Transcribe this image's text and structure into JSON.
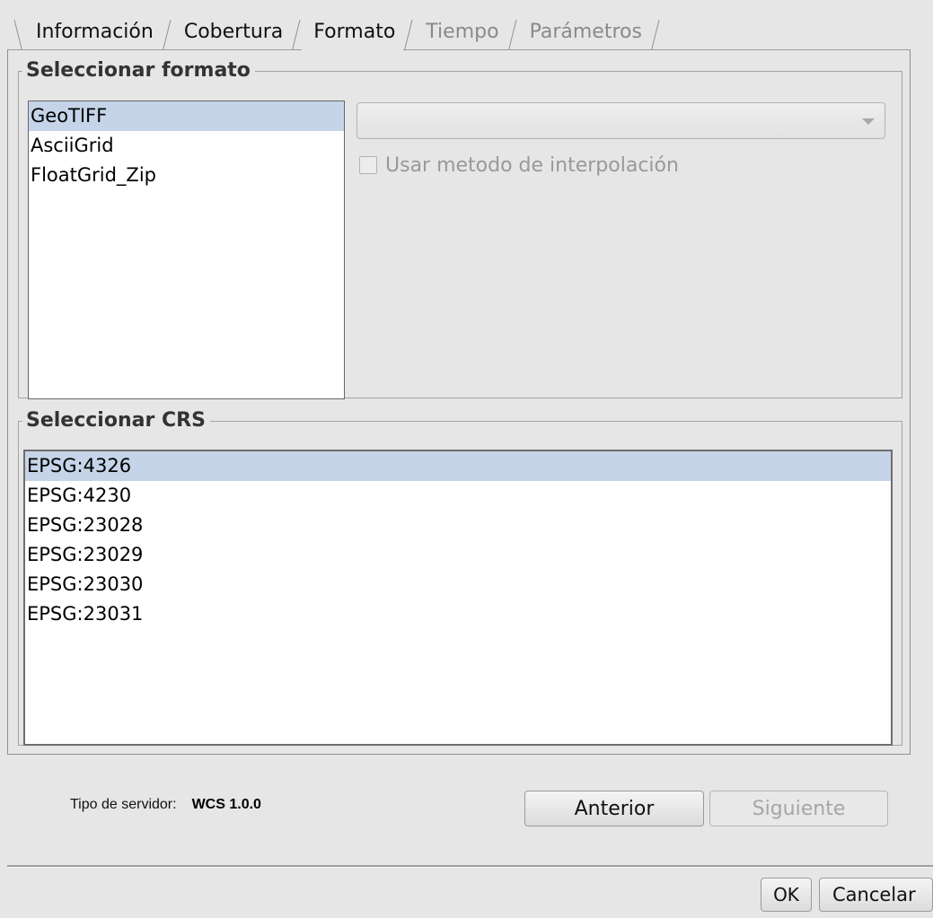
{
  "tabs": [
    {
      "label": "Información",
      "state": "normal"
    },
    {
      "label": "Cobertura",
      "state": "normal"
    },
    {
      "label": "Formato",
      "state": "active"
    },
    {
      "label": "Tiempo",
      "state": "disabled"
    },
    {
      "label": "Parámetros",
      "state": "disabled"
    }
  ],
  "format_group": {
    "title": "Seleccionar formato",
    "formats": [
      "GeoTIFF",
      "AsciiGrid",
      "FloatGrid_Zip"
    ],
    "selected_format": "GeoTIFF",
    "interpolation_value": "",
    "interpolation_label": "Usar metodo de interpolación",
    "interpolation_checked": false
  },
  "crs_group": {
    "title": "Seleccionar CRS",
    "items": [
      "EPSG:4326",
      "EPSG:4230",
      "EPSG:23028",
      "EPSG:23029",
      "EPSG:23030",
      "EPSG:23031"
    ],
    "selected": "EPSG:4326"
  },
  "server": {
    "label": "Tipo de servidor:",
    "value": "WCS 1.0.0"
  },
  "nav": {
    "prev_label": "Anterior",
    "next_label": "Siguiente"
  },
  "dialog": {
    "ok_label": "OK",
    "cancel_label": "Cancelar"
  },
  "colors": {
    "selection": "#c5d4e8",
    "background": "#e6e6e6"
  }
}
